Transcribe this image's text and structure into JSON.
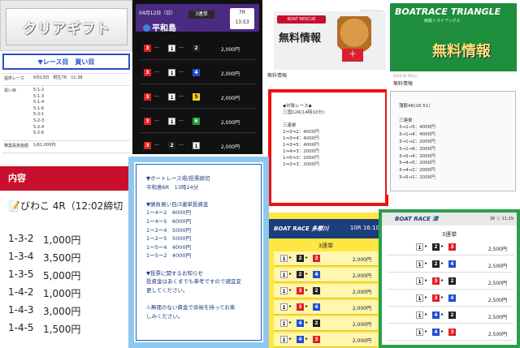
{
  "p1": {
    "logo": "クリアギフト"
  },
  "p2": {
    "header": "▼レース目　買い目",
    "rows": [
      {
        "k": "提供レース",
        "v": "6月13日　桐生7R　11:38"
      },
      {
        "k": "買い目",
        "v": "5-1-2\n5-1-3\n5-1-4\n5-1-6\n5-2-1\n5-2-3\n5-2-4\n5-2-6"
      },
      {
        "k": "推奨投資金額",
        "v": "1点1,000円"
      }
    ]
  },
  "p3": {
    "date": "04月12日（日）",
    "type": "3連単",
    "race_no": "7R",
    "time": "13:53",
    "venue": "平和島",
    "combos": [
      {
        "a": "3",
        "b": "1",
        "c": "2",
        "pay": "2,000円"
      },
      {
        "a": "3",
        "b": "1",
        "c": "4",
        "pay": "2,000円"
      },
      {
        "a": "3",
        "b": "1",
        "c": "5",
        "pay": "2,000円"
      },
      {
        "a": "3",
        "b": "1",
        "c": "6",
        "pay": "2,000円"
      },
      {
        "a": "3",
        "b": "2",
        "c": "1",
        "pay": "2,000円"
      }
    ],
    "colors": {
      "1": "#ffffff",
      "2": "#222222",
      "3": "#e02020",
      "4": "#2050d0",
      "5": "#f0d020",
      "6": "#20a040"
    }
  },
  "p4": {
    "brand": "BOAT RESCUE",
    "big": "無料情報",
    "kit": "＋",
    "date": "2025.07.04(金)",
    "label": "無料情報"
  },
  "p5": {
    "text": "◆対象レース◆\n三国12R(14時10分)\n\n三連単\n1⇒3⇒2：4000円\n1⇒3⇒4：4000円\n1⇒3⇒5：4000円\n1⇒4⇒3：2000円\n1⇒5⇒3：2000円\n1⇒2⇒3：2000円"
  },
  "p6": {
    "brand": "BOATRACE TRIANGLE",
    "sub": "競艇トライアングル",
    "free": "無料情報",
    "date": "2026.05.20(土)",
    "label": "無料情報",
    "text": "蒲郡4R(16:51)\n\n三連単\n3→1→5：4000円\n3→1→4：4000円\n3→1→2：2000円\n3→1→6：2000円\n3→5→4：2000円\n3→4→5：2000円\n3→4→2：2000円\n3→5→1：2000円"
  },
  "p7": {
    "header": "内容",
    "race": "📝びわこ 4R（12:02締切",
    "lines": [
      {
        "c": "1-3-2",
        "p": "1,000円"
      },
      {
        "c": "1-3-4",
        "p": "3,500円"
      },
      {
        "c": "1-3-5",
        "p": "5,000円"
      },
      {
        "c": "1-4-2",
        "p": "1,000円"
      },
      {
        "c": "1-4-3",
        "p": "3,000円"
      },
      {
        "c": "1-4-5",
        "p": "1,500円"
      }
    ]
  },
  "p8": {
    "text": "▼ボートレース場/投票締切\n平和島6R　13時24分\n\n▼勝負買い目/3連単投資金\n1ー4ー2　6000円\n1ー4ー5　6000円\n1ー2ー4　5000円\n1ー2ー5　5000円\n1ー5ー4　4000円\n1ー5ー2　4000円\n\n▼投票に関するお知らせ\n投資金はあくまでも参考ですので適宜変\n更してください。\n\n⚠無理のない資金で余裕を持ってお楽\nしみください。"
  },
  "p9": {
    "brand": "BOAT RACE 多摩川",
    "race": "10R 16:10",
    "type": "3連単",
    "rows": [
      {
        "a": "1",
        "b": "2",
        "c": "3",
        "pay": "2,000円"
      },
      {
        "a": "1",
        "b": "2",
        "c": "4",
        "pay": "2,000円"
      },
      {
        "a": "1",
        "b": "3",
        "c": "2",
        "pay": "2,000円"
      },
      {
        "a": "1",
        "b": "3",
        "c": "4",
        "pay": "2,000円"
      },
      {
        "a": "1",
        "b": "4",
        "c": "2",
        "pay": "2,000円"
      },
      {
        "a": "1",
        "b": "4",
        "c": "3",
        "pay": "2,000円"
      }
    ]
  },
  "p10": {
    "brand": "BOAT RACE 津",
    "race": "3R ⓒ 11:29",
    "type": "3連単",
    "rows": [
      {
        "a": "1",
        "b": "2",
        "c": "3",
        "pay": "2,500円"
      },
      {
        "a": "1",
        "b": "2",
        "c": "4",
        "pay": "2,500円"
      },
      {
        "a": "1",
        "b": "3",
        "c": "2",
        "pay": "2,500円"
      },
      {
        "a": "1",
        "b": "3",
        "c": "4",
        "pay": "2,500円"
      },
      {
        "a": "1",
        "b": "4",
        "c": "2",
        "pay": "2,500円"
      },
      {
        "a": "1",
        "b": "4",
        "c": "3",
        "pay": "2,500円"
      }
    ]
  }
}
